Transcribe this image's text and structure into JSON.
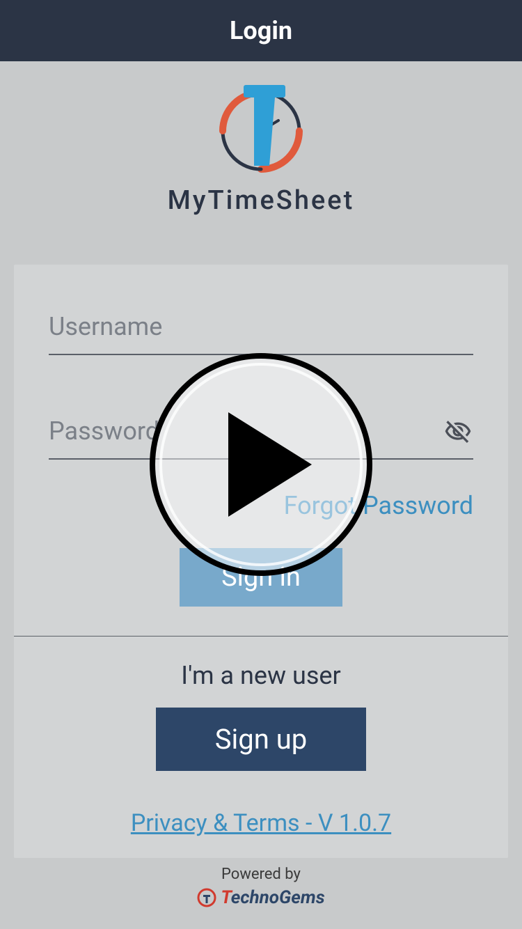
{
  "header": {
    "title": "Login"
  },
  "logo": {
    "appName": "MyTimeSheet"
  },
  "form": {
    "usernamePlaceholder": "Username",
    "passwordPlaceholder": "Password",
    "forgotPassword": "Forgot Password",
    "signIn": "Sign in"
  },
  "signup": {
    "newUserText": "I'm a new user",
    "signUpLabel": "Sign up"
  },
  "privacy": {
    "text": "Privacy & Terms - V 1.0.7"
  },
  "footer": {
    "poweredBy": "Powered by",
    "brandT": "T",
    "brandRest": "echnoGems"
  }
}
